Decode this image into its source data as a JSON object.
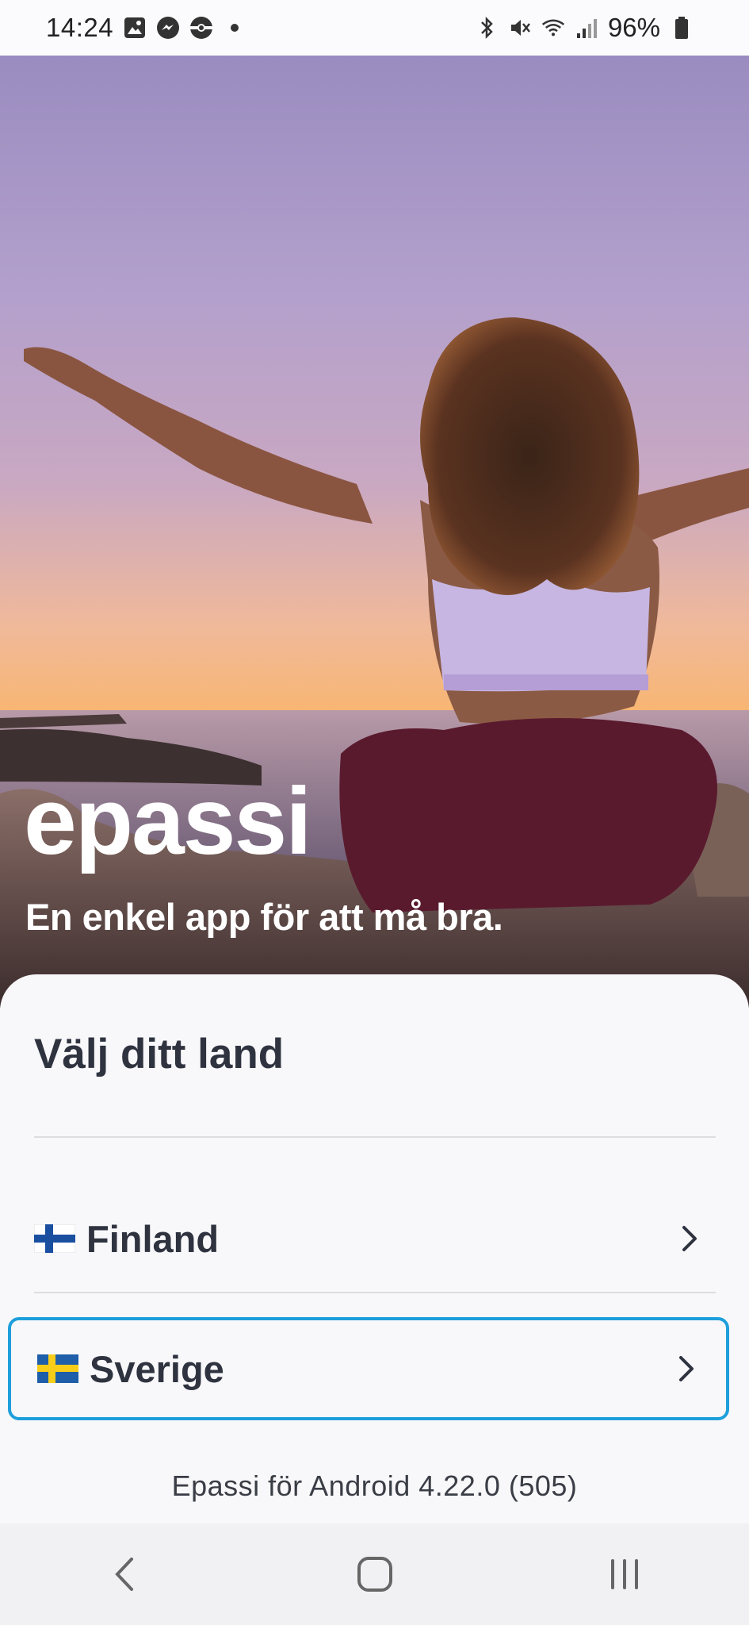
{
  "status_bar": {
    "time": "14:24",
    "left_icons": [
      "gallery-icon",
      "messenger-icon",
      "pokeball-icon",
      "dot-icon"
    ],
    "right_icons": [
      "bluetooth-icon",
      "mute-icon",
      "wifi-icon",
      "signal-icon",
      "battery-icon"
    ],
    "battery": "96%"
  },
  "hero": {
    "logo": "epassi",
    "tagline": "En enkel app för att må bra."
  },
  "sheet": {
    "title": "Välj ditt land",
    "countries": [
      {
        "flag": "finland-flag-icon",
        "label": "Finland"
      },
      {
        "flag": "sweden-flag-icon",
        "label": "Sverige",
        "focused": true
      }
    ],
    "version": "Epassi för Android 4.22.0 (505)"
  },
  "nav_bar": {
    "buttons": [
      "back-icon",
      "home-icon",
      "recents-icon"
    ]
  },
  "colors": {
    "focus_border": "#1e9fdb",
    "text_dark": "#2f3340",
    "sheet_bg": "#f8f8fa"
  }
}
